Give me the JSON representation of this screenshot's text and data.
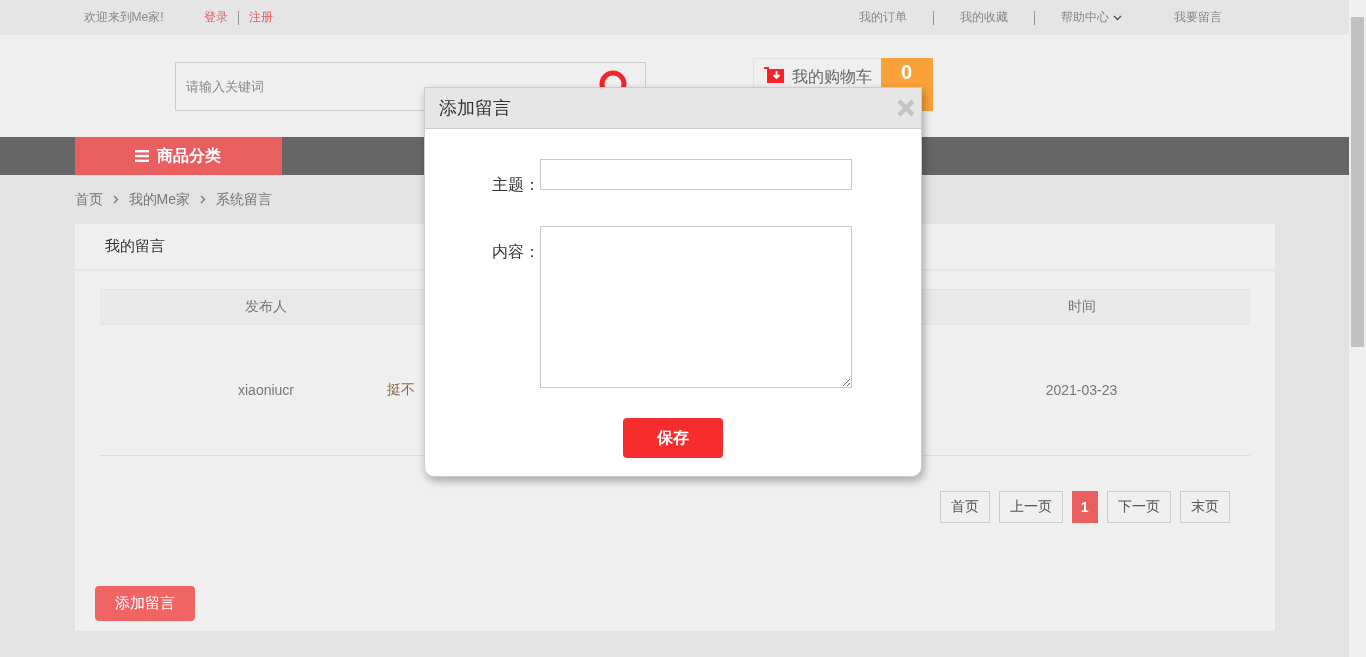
{
  "top_bar": {
    "welcome": "欢迎来到Me家!",
    "login": "登录",
    "register": "注册",
    "links": [
      {
        "label": "我的订单",
        "dropdown": false
      },
      {
        "label": "我的收藏",
        "dropdown": false
      },
      {
        "label": "帮助中心",
        "dropdown": true
      },
      {
        "label": "我要留言",
        "dropdown": false
      }
    ]
  },
  "header": {
    "search": {
      "placeholder": "请输入关键词"
    },
    "cart": {
      "label": "我的购物车",
      "count": "0"
    }
  },
  "nav": {
    "category_button": "商品分类"
  },
  "breadcrumb": [
    "首页",
    "我的Me家",
    "系统留言"
  ],
  "panel": {
    "title": "我的留言",
    "table": {
      "columns": [
        "发布人",
        "",
        "时间"
      ],
      "rows": [
        {
          "cells": [
            "xiaoniucr",
            "挺不",
            "2021-03-23"
          ]
        }
      ]
    },
    "pagination": [
      {
        "label": "首页",
        "selected": false
      },
      {
        "label": "上一页",
        "selected": false
      },
      {
        "label": "1",
        "selected": true
      },
      {
        "label": "下一页",
        "selected": false
      },
      {
        "label": "末页",
        "selected": false
      }
    ],
    "add_button": "添加留言"
  },
  "dialog": {
    "title": "添加留言",
    "fields": [
      {
        "label": "主题：",
        "kind": "text"
      },
      {
        "label": "内容：",
        "kind": "textarea"
      }
    ],
    "save_button": "保存"
  }
}
